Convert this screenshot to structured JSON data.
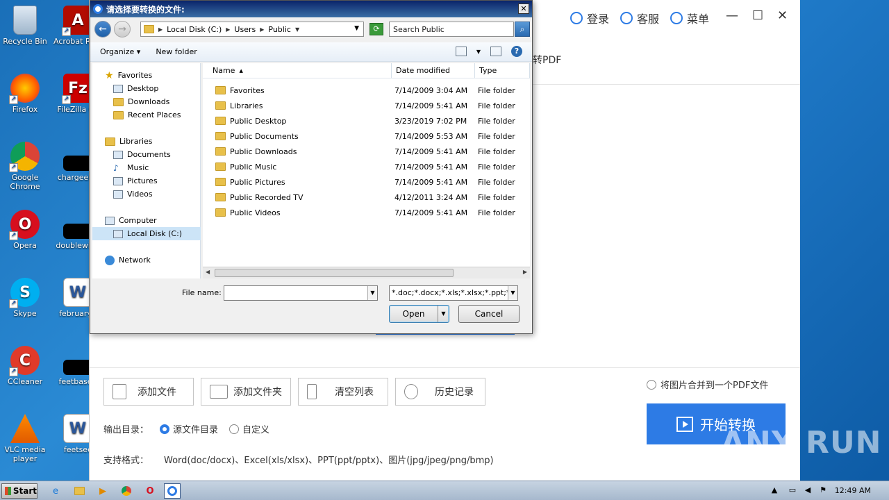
{
  "desktop": {
    "icons": [
      {
        "label": "Recycle Bin"
      },
      {
        "label": "Acrobat Reader D"
      },
      {
        "label": "Firefox"
      },
      {
        "label": "FileZilla Cli"
      },
      {
        "label": "Google Chrome"
      },
      {
        "label": "chargeeng"
      },
      {
        "label": "Opera"
      },
      {
        "label": "doublewide"
      },
      {
        "label": "Skype"
      },
      {
        "label": "februaryp"
      },
      {
        "label": "CCleaner"
      },
      {
        "label": "feetbased"
      },
      {
        "label": "VLC media player"
      },
      {
        "label": "feetsec"
      }
    ]
  },
  "app": {
    "top_login": "登录",
    "top_service": "客服",
    "top_menu": "菜单",
    "minimize": "—",
    "maximize": "☐",
    "close": "✕",
    "subtitle_fragment": "转PDF",
    "buttons": {
      "add_file": "添加文件",
      "add_folder": "添加文件夹",
      "clear_list": "清空列表",
      "history": "历史记录"
    },
    "merge_option": "将图片合并到一个PDF文件",
    "start_convert": "开始转换",
    "output_label": "输出目录：",
    "output_source": "源文件目录",
    "output_custom": "自定义",
    "formats_label": "支持格式：",
    "formats_value": "Word(doc/docx)、Excel(xls/xlsx)、PPT(ppt/pptx)、图片(jpg/jpeg/png/bmp)"
  },
  "watermark": "ANY RUN",
  "dialog": {
    "title": "请选择要转换的文件:",
    "close": "✕",
    "breadcrumb": [
      "Local Disk (C:)",
      "Users",
      "Public"
    ],
    "search_placeholder": "Search Public",
    "organize": "Organize",
    "new_folder": "New folder",
    "nav": {
      "favorites": "Favorites",
      "desktop": "Desktop",
      "downloads": "Downloads",
      "recent": "Recent Places",
      "libraries": "Libraries",
      "documents": "Documents",
      "music": "Music",
      "pictures": "Pictures",
      "videos": "Videos",
      "computer": "Computer",
      "local_disk": "Local Disk (C:)",
      "network": "Network"
    },
    "columns": {
      "name": "Name",
      "date": "Date modified",
      "type": "Type"
    },
    "files": [
      {
        "name": "Favorites",
        "date": "7/14/2009 3:04 AM",
        "type": "File folder"
      },
      {
        "name": "Libraries",
        "date": "7/14/2009 5:41 AM",
        "type": "File folder"
      },
      {
        "name": "Public Desktop",
        "date": "3/23/2019 7:02 PM",
        "type": "File folder"
      },
      {
        "name": "Public Documents",
        "date": "7/14/2009 5:53 AM",
        "type": "File folder"
      },
      {
        "name": "Public Downloads",
        "date": "7/14/2009 5:41 AM",
        "type": "File folder"
      },
      {
        "name": "Public Music",
        "date": "7/14/2009 5:41 AM",
        "type": "File folder"
      },
      {
        "name": "Public Pictures",
        "date": "7/14/2009 5:41 AM",
        "type": "File folder"
      },
      {
        "name": "Public Recorded TV",
        "date": "4/12/2011 3:24 AM",
        "type": "File folder"
      },
      {
        "name": "Public Videos",
        "date": "7/14/2009 5:41 AM",
        "type": "File folder"
      }
    ],
    "file_name_label": "File name:",
    "file_name_value": "",
    "file_type_value": "*.doc;*.docx;*.xls;*.xlsx;*.ppt;*.p",
    "open": "Open",
    "cancel": "Cancel"
  },
  "taskbar": {
    "start": "Start",
    "clock": "12:49 AM"
  }
}
